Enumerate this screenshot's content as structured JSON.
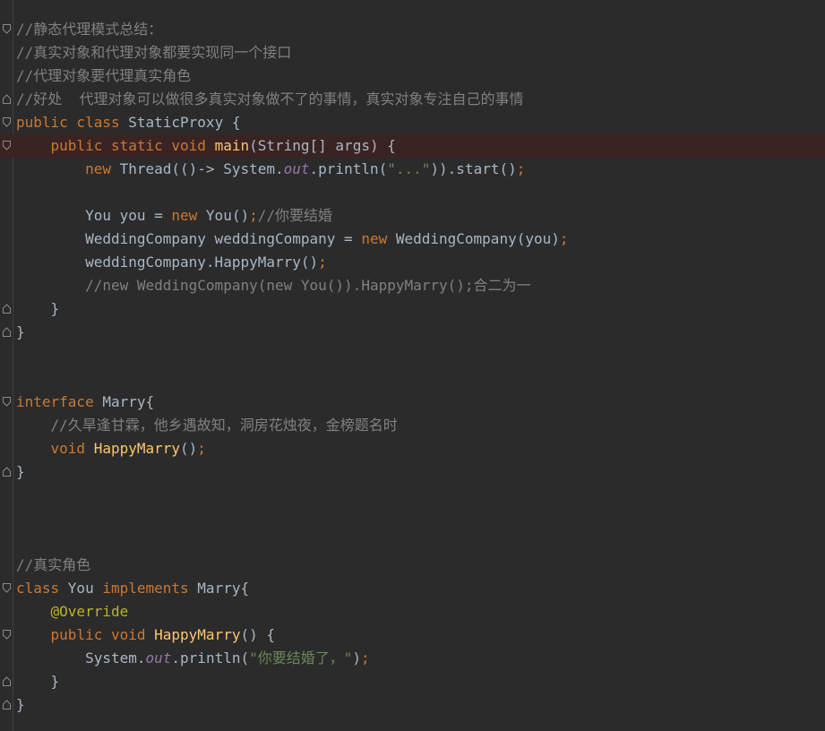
{
  "editor": {
    "language": "java",
    "lines": [
      {
        "tokens": [
          {
            "t": "cmt",
            "v": "//静态代理模式总结："
          }
        ],
        "fold": "open"
      },
      {
        "tokens": [
          {
            "t": "cmt",
            "v": "//真实对象和代理对象都要实现同一个接口"
          }
        ]
      },
      {
        "tokens": [
          {
            "t": "cmt",
            "v": "//代理对象要代理真实角色"
          }
        ]
      },
      {
        "tokens": [
          {
            "t": "cmt",
            "v": "//好处  代理对象可以做很多真实对象做不了的事情，真实对象专注自己的事情"
          }
        ],
        "fold": "close"
      },
      {
        "tokens": [
          {
            "t": "kw",
            "v": "public class "
          },
          {
            "t": "cls",
            "v": "StaticProxy "
          },
          {
            "t": "pl",
            "v": "{"
          }
        ],
        "fold": "open"
      },
      {
        "tokens": [
          {
            "t": "pl",
            "v": "    "
          },
          {
            "t": "kw",
            "v": "public static void "
          },
          {
            "t": "fn",
            "v": "main"
          },
          {
            "t": "pl",
            "v": "(String[] args) {"
          }
        ],
        "fold": "open",
        "highlight": true
      },
      {
        "tokens": [
          {
            "t": "pl",
            "v": "        "
          },
          {
            "t": "kw",
            "v": "new "
          },
          {
            "t": "pl",
            "v": "Thread(()-> System."
          },
          {
            "t": "fld",
            "v": "out"
          },
          {
            "t": "pl",
            "v": ".println("
          },
          {
            "t": "str",
            "v": "\"...\""
          },
          {
            "t": "pl",
            "v": ")).start()"
          },
          {
            "t": "kw",
            "v": ";"
          }
        ]
      },
      {
        "tokens": []
      },
      {
        "tokens": [
          {
            "t": "pl",
            "v": "        You you = "
          },
          {
            "t": "kw",
            "v": "new "
          },
          {
            "t": "pl",
            "v": "You()"
          },
          {
            "t": "kw",
            "v": ";"
          },
          {
            "t": "cmt",
            "v": "//你要结婚"
          }
        ]
      },
      {
        "tokens": [
          {
            "t": "pl",
            "v": "        WeddingCompany weddingCompany = "
          },
          {
            "t": "kw",
            "v": "new "
          },
          {
            "t": "pl",
            "v": "WeddingCompany(you)"
          },
          {
            "t": "kw",
            "v": ";"
          }
        ]
      },
      {
        "tokens": [
          {
            "t": "pl",
            "v": "        weddingCompany.HappyMarry()"
          },
          {
            "t": "kw",
            "v": ";"
          }
        ]
      },
      {
        "tokens": [
          {
            "t": "pl",
            "v": "        "
          },
          {
            "t": "cmt",
            "v": "//new WeddingCompany(new You()).HappyMarry();合二为一"
          }
        ]
      },
      {
        "tokens": [
          {
            "t": "pl",
            "v": "    }"
          }
        ],
        "fold": "close"
      },
      {
        "tokens": [
          {
            "t": "pl",
            "v": "}"
          }
        ],
        "fold": "close"
      },
      {
        "tokens": []
      },
      {
        "tokens": []
      },
      {
        "tokens": [
          {
            "t": "kw",
            "v": "interface "
          },
          {
            "t": "cls",
            "v": "Marry"
          },
          {
            "t": "pl",
            "v": "{"
          }
        ],
        "fold": "open"
      },
      {
        "tokens": [
          {
            "t": "pl",
            "v": "    "
          },
          {
            "t": "cmt",
            "v": "//久旱逢甘霖，他乡遇故知，洞房花烛夜，金榜题名时"
          }
        ]
      },
      {
        "tokens": [
          {
            "t": "pl",
            "v": "    "
          },
          {
            "t": "kw",
            "v": "void "
          },
          {
            "t": "fn",
            "v": "HappyMarry"
          },
          {
            "t": "pl",
            "v": "()"
          },
          {
            "t": "kw",
            "v": ";"
          }
        ]
      },
      {
        "tokens": [
          {
            "t": "pl",
            "v": "}"
          }
        ],
        "fold": "close"
      },
      {
        "tokens": []
      },
      {
        "tokens": []
      },
      {
        "tokens": []
      },
      {
        "tokens": [
          {
            "t": "cmt",
            "v": "//真实角色"
          }
        ]
      },
      {
        "tokens": [
          {
            "t": "kw",
            "v": "class "
          },
          {
            "t": "cls",
            "v": "You "
          },
          {
            "t": "kw",
            "v": "implements "
          },
          {
            "t": "cls",
            "v": "Marry"
          },
          {
            "t": "pl",
            "v": "{"
          }
        ],
        "fold": "open"
      },
      {
        "tokens": [
          {
            "t": "pl",
            "v": "    "
          },
          {
            "t": "ann",
            "v": "@Override"
          }
        ]
      },
      {
        "tokens": [
          {
            "t": "pl",
            "v": "    "
          },
          {
            "t": "kw",
            "v": "public void "
          },
          {
            "t": "fn",
            "v": "HappyMarry"
          },
          {
            "t": "pl",
            "v": "() {"
          }
        ],
        "fold": "open"
      },
      {
        "tokens": [
          {
            "t": "pl",
            "v": "        System."
          },
          {
            "t": "fld",
            "v": "out"
          },
          {
            "t": "pl",
            "v": ".println("
          },
          {
            "t": "str",
            "v": "\"你要结婚了，\""
          },
          {
            "t": "pl",
            "v": ")"
          },
          {
            "t": "kw",
            "v": ";"
          }
        ]
      },
      {
        "tokens": [
          {
            "t": "pl",
            "v": "    }"
          }
        ],
        "fold": "close"
      },
      {
        "tokens": [
          {
            "t": "pl",
            "v": "}"
          }
        ],
        "fold": "close"
      }
    ]
  },
  "colors": {
    "background": "#2b2b2b",
    "keyword": "#cc7832",
    "method": "#ffc66d",
    "string": "#6a8759",
    "comment": "#808080",
    "field": "#9876aa",
    "annotation": "#bbb529",
    "plain": "#a9b7c6",
    "highlight_line": "#3a2323"
  }
}
